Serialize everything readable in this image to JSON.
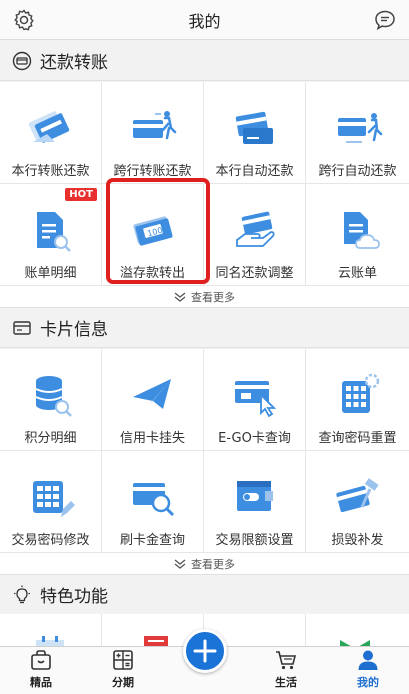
{
  "header": {
    "title": "我的",
    "settings_icon": "gear-icon",
    "message_icon": "chat-bubble-icon"
  },
  "sections": [
    {
      "title": "还款转账",
      "icon": "repayment-icon",
      "items": [
        {
          "label": "本行转账还款",
          "icon": "card-transfer-icon"
        },
        {
          "label": "跨行转账还款",
          "icon": "card-run-icon"
        },
        {
          "label": "本行自动还款",
          "icon": "card-auto-icon"
        },
        {
          "label": "跨行自动还款",
          "icon": "card-auto-run-icon"
        },
        {
          "label": "账单明细",
          "icon": "bill-search-icon",
          "badge": "HOT"
        },
        {
          "label": "溢存款转出",
          "icon": "banknote-icon",
          "highlighted": true
        },
        {
          "label": "同名还款调整",
          "icon": "hand-card-icon"
        },
        {
          "label": "云账单",
          "icon": "cloud-bill-icon"
        }
      ],
      "more_label": "查看更多"
    },
    {
      "title": "卡片信息",
      "icon": "card-info-icon",
      "items": [
        {
          "label": "积分明细",
          "icon": "database-search-icon"
        },
        {
          "label": "信用卡挂失",
          "icon": "paper-plane-card-icon"
        },
        {
          "label": "E-GO卡查询",
          "icon": "ego-card-icon"
        },
        {
          "label": "查询密码重置",
          "icon": "keypad-gear-icon"
        },
        {
          "label": "交易密码修改",
          "icon": "keypad-pen-icon"
        },
        {
          "label": "刷卡金查询",
          "icon": "card-magnifier-icon"
        },
        {
          "label": "交易限额设置",
          "icon": "browser-toggle-icon"
        },
        {
          "label": "损毁补发",
          "icon": "card-hammer-icon"
        }
      ],
      "more_label": "查看更多"
    },
    {
      "title": "特色功能",
      "icon": "lightbulb-icon"
    }
  ],
  "tabbar": [
    {
      "label": "精品",
      "icon": "bag-icon"
    },
    {
      "label": "分期",
      "icon": "calculator-icon"
    },
    {
      "label": "",
      "icon": "plus-icon"
    },
    {
      "label": "生活",
      "icon": "cart-icon"
    },
    {
      "label": "我的",
      "icon": "user-icon",
      "active": true
    }
  ],
  "colors": {
    "accent": "#1f6fd0",
    "highlight": "#e01f1f",
    "hot": "#e8302e"
  }
}
